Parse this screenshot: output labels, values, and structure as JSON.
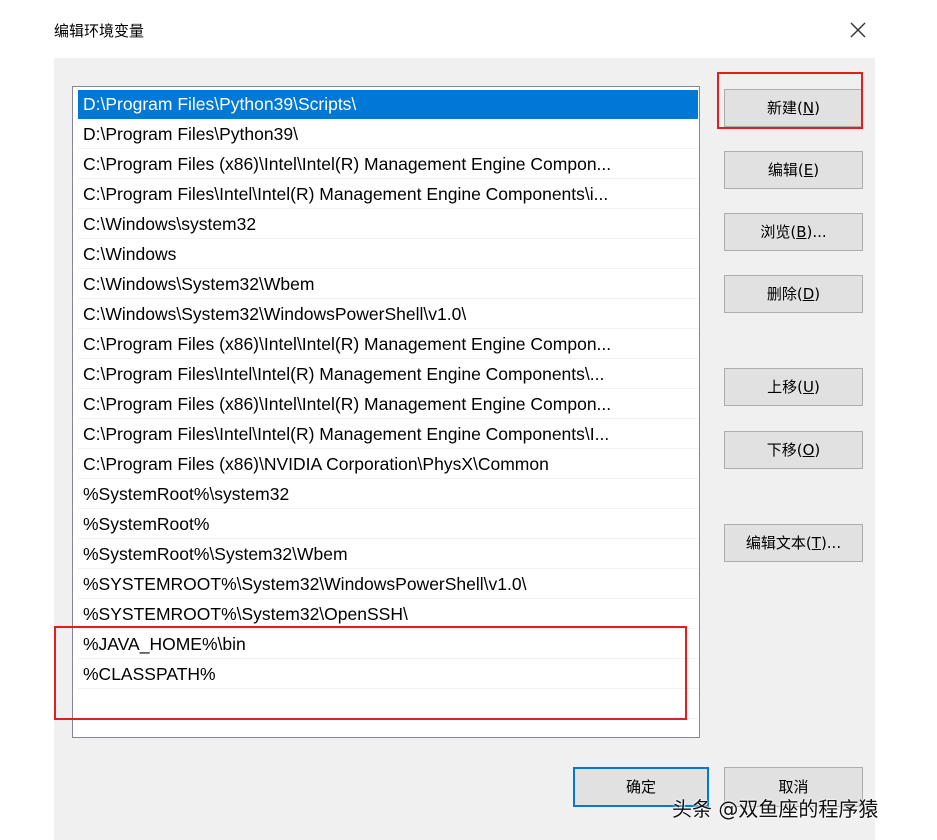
{
  "dialog": {
    "title": "编辑环境变量",
    "close_icon": "close-icon"
  },
  "list": {
    "selected_index": 0,
    "items": [
      "D:\\Program Files\\Python39\\Scripts\\",
      "D:\\Program Files\\Python39\\",
      "C:\\Program Files (x86)\\Intel\\Intel(R) Management Engine Compon...",
      "C:\\Program Files\\Intel\\Intel(R) Management Engine Components\\i...",
      "C:\\Windows\\system32",
      "C:\\Windows",
      "C:\\Windows\\System32\\Wbem",
      "C:\\Windows\\System32\\WindowsPowerShell\\v1.0\\",
      "C:\\Program Files (x86)\\Intel\\Intel(R) Management Engine Compon...",
      "C:\\Program Files\\Intel\\Intel(R) Management Engine Components\\...",
      "C:\\Program Files (x86)\\Intel\\Intel(R) Management Engine Compon...",
      "C:\\Program Files\\Intel\\Intel(R) Management Engine Components\\I...",
      "C:\\Program Files (x86)\\NVIDIA Corporation\\PhysX\\Common",
      "%SystemRoot%\\system32",
      "%SystemRoot%",
      "%SystemRoot%\\System32\\Wbem",
      "%SYSTEMROOT%\\System32\\WindowsPowerShell\\v1.0\\",
      "%SYSTEMROOT%\\System32\\OpenSSH\\",
      "%JAVA_HOME%\\bin",
      "%CLASSPATH%",
      ""
    ]
  },
  "buttons": {
    "new": {
      "text": "新建(",
      "key": "N",
      "suffix": ")"
    },
    "edit": {
      "text": "编辑(",
      "key": "E",
      "suffix": ")"
    },
    "browse": {
      "text": "浏览(",
      "key": "B",
      "suffix": ")..."
    },
    "delete": {
      "text": "删除(",
      "key": "D",
      "suffix": ")"
    },
    "move_up": {
      "text": "上移(",
      "key": "U",
      "suffix": ")"
    },
    "move_down": {
      "text": "下移(",
      "key": "O",
      "suffix": ")"
    },
    "edit_text": {
      "text": "编辑文本(",
      "key": "T",
      "suffix": ")..."
    },
    "ok": "确定",
    "cancel": "取消"
  },
  "watermark": "头条 @双鱼座的程序猿",
  "colors": {
    "selection": "#0078d7",
    "highlight_box": "#e02020",
    "panel_bg": "#f0f0f0"
  }
}
